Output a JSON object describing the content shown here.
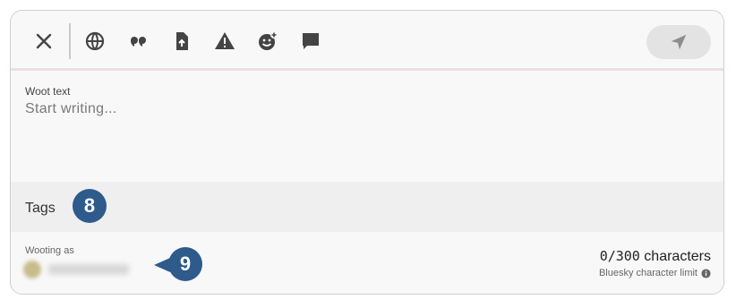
{
  "toolbar": {
    "icons": [
      "close-icon",
      "globe-icon",
      "quote-icon",
      "file-upload-icon",
      "warning-icon",
      "emoji-add-icon",
      "comment-icon"
    ],
    "send_icon": "send-icon"
  },
  "composer": {
    "label": "Woot text",
    "placeholder": "Start writing..."
  },
  "tags": {
    "label": "Tags",
    "badge": "8"
  },
  "footer": {
    "wooting_label": "Wooting as",
    "badge": "9",
    "count": "0/300",
    "count_suffix": "characters",
    "limit_label": "Bluesky character limit"
  },
  "colors": {
    "badge": "#2e5b8c",
    "toolbar_border": "#eadfe1"
  }
}
